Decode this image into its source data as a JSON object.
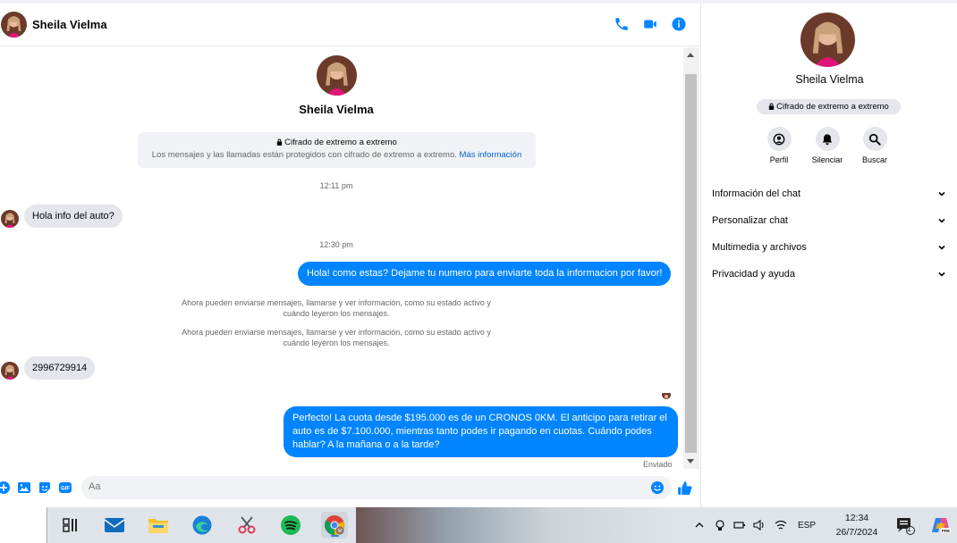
{
  "contact": {
    "name": "Sheila Vielma"
  },
  "header": {
    "icons": [
      "phone-icon",
      "video-icon",
      "info-icon"
    ],
    "accent": "#0084ff"
  },
  "thread": {
    "e2e": {
      "title": "Cifrado de extremo a extremo",
      "desc": "Los mensajes y las llamadas están protegidos con cifrado de extremo a extremo.",
      "link": "Más información"
    },
    "time1": "12:11 pm",
    "msg1": "Hola info del auto?",
    "time2": "12:30 pm",
    "msg2": "Hola! como estas? Dejame tu numero para enviarte toda la informacion por favor!",
    "sys1": "Ahora pueden enviarse mensajes, llamarse y ver información, como su estado activo y cuándo leyeron los mensajes.",
    "sys2": "Ahora pueden enviarse mensajes, llamarse y ver información, como su estado activo y cuándo leyeron los mensajes.",
    "msg3": "2996729914",
    "msg4": "Perfecto! La cuota desde $195.000 es de un CRONOS 0KM. El anticipo para retirar el auto es de $7.100.000, mientras tanto podes ir pagando en cuotas. Cuándo podes hablar? A la mañana o a la tarde?",
    "status": "Enviado"
  },
  "composer": {
    "placeholder": "Aa"
  },
  "info": {
    "e2e_badge": "Cifrado de extremo a extremo",
    "actions": [
      {
        "label": "Perfil",
        "icon": "profile-icon"
      },
      {
        "label": "Silenciar",
        "icon": "bell-icon"
      },
      {
        "label": "Buscar",
        "icon": "search-icon"
      }
    ],
    "sections": [
      "Información del chat",
      "Personalizar chat",
      "Multimedia y archivos",
      "Privacidad y ayuda"
    ]
  },
  "taskbar": {
    "lang": "ESP",
    "time": "12:34",
    "date": "26/7/2024",
    "notif_count": "1"
  }
}
